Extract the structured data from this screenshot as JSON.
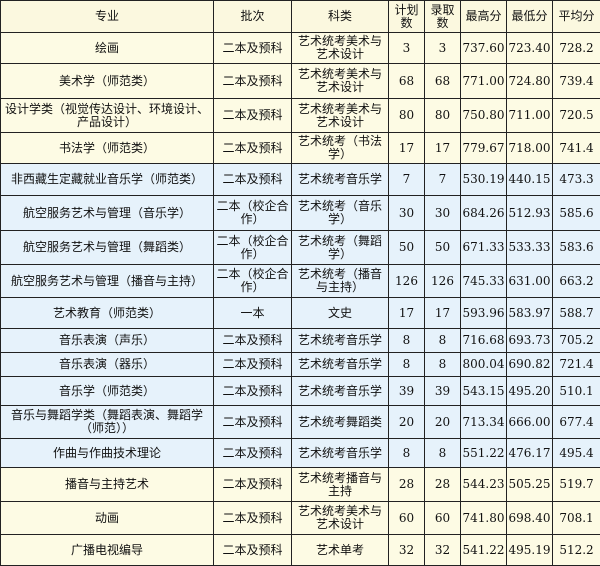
{
  "table": {
    "headers": [
      "专业",
      "批次",
      "科类",
      "计划数",
      "录取数",
      "最高分",
      "最低分",
      "平均分"
    ],
    "rows": [
      {
        "group": "a",
        "cells": [
          "绘画",
          "二本及预科",
          "艺术统考美术与艺术设计",
          "3",
          "3",
          "737.60",
          "723.40",
          "728.2"
        ]
      },
      {
        "group": "a",
        "cells": [
          "美术学（师范类）",
          "二本及预科",
          "艺术统考美术与艺术设计",
          "68",
          "68",
          "771.00",
          "724.80",
          "739.4"
        ]
      },
      {
        "group": "a",
        "cells": [
          "设计学类（视觉传达设计、环境设计、产品设计）",
          "二本及预科",
          "艺术统考美术与艺术设计",
          "80",
          "80",
          "750.80",
          "711.00",
          "720.5"
        ]
      },
      {
        "group": "a",
        "cells": [
          "书法学（师范类）",
          "二本及预科",
          "艺术统考（书法学）",
          "17",
          "17",
          "779.67",
          "718.00",
          "741.4"
        ]
      },
      {
        "group": "b",
        "cells": [
          "非西藏生定藏就业音乐学（师范类）",
          "二本及预科",
          "艺术统考音乐学",
          "7",
          "7",
          "530.19",
          "440.15",
          "473.3"
        ]
      },
      {
        "group": "b",
        "cells": [
          "航空服务艺术与管理（音乐学）",
          "二本（校企合作）",
          "艺术统考（音乐学）",
          "30",
          "30",
          "684.26",
          "512.93",
          "585.6"
        ]
      },
      {
        "group": "b",
        "cells": [
          "航空服务艺术与管理（舞蹈类）",
          "二本（校企合作）",
          "艺术统考（舞蹈学）",
          "50",
          "50",
          "671.33",
          "533.33",
          "583.6"
        ]
      },
      {
        "group": "b",
        "cells": [
          "航空服务艺术与管理（播音与主持）",
          "二本（校企合作）",
          "艺术统考（播音与主持）",
          "126",
          "126",
          "745.33",
          "631.00",
          "663.2"
        ]
      },
      {
        "group": "b",
        "cells": [
          "艺术教育（师范类）",
          "一本",
          "文史",
          "17",
          "17",
          "593.96",
          "583.97",
          "588.7"
        ]
      },
      {
        "group": "b",
        "cells": [
          "音乐表演（声乐）",
          "二本及预科",
          "艺术统考音乐学",
          "8",
          "8",
          "716.68",
          "693.73",
          "705.2"
        ]
      },
      {
        "group": "b",
        "cells": [
          "音乐表演（器乐）",
          "二本及预科",
          "艺术统考音乐学",
          "8",
          "8",
          "800.04",
          "690.82",
          "721.4"
        ]
      },
      {
        "group": "b",
        "cells": [
          "音乐学（师范类）",
          "二本及预科",
          "艺术统考音乐学",
          "39",
          "39",
          "543.15",
          "495.20",
          "510.1"
        ]
      },
      {
        "group": "b",
        "cells": [
          "音乐与舞蹈学类（舞蹈表演、舞蹈学（师范））",
          "二本及预科",
          "艺术统考舞蹈类",
          "20",
          "20",
          "713.34",
          "666.00",
          "677.4"
        ]
      },
      {
        "group": "b",
        "cells": [
          "作曲与作曲技术理论",
          "二本及预科",
          "艺术统考音乐学",
          "8",
          "8",
          "551.22",
          "476.17",
          "495.4"
        ]
      },
      {
        "group": "c",
        "cells": [
          "播音与主持艺术",
          "二本及预科",
          "艺术统考播音与主持",
          "28",
          "28",
          "544.23",
          "505.25",
          "519.7"
        ]
      },
      {
        "group": "c",
        "cells": [
          "动画",
          "二本及预科",
          "艺术统考美术与艺术设计",
          "60",
          "60",
          "741.80",
          "698.40",
          "708.1"
        ]
      },
      {
        "group": "c",
        "cells": [
          "广播电视编导",
          "二本及预科",
          "艺术单考",
          "32",
          "32",
          "541.22",
          "495.19",
          "512.2"
        ]
      }
    ]
  }
}
